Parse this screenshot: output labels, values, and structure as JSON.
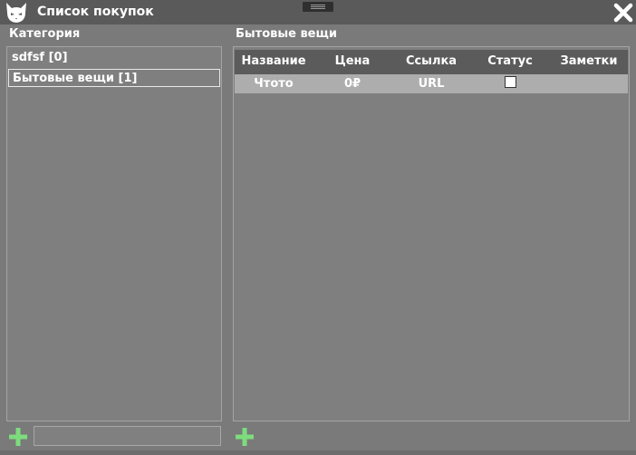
{
  "window": {
    "title": "Список покупок",
    "app_icon": "cat-head-icon",
    "close_icon": "close-icon"
  },
  "categories": {
    "header": "Категория",
    "items": [
      {
        "label": "sdfsf [0]",
        "selected": false
      },
      {
        "label": "Бытовые вещи [1]",
        "selected": true
      }
    ],
    "new_category_value": "",
    "add_icon": "plus-icon"
  },
  "items_panel": {
    "header": "Бытовые вещи",
    "columns": [
      "Название",
      "Цена",
      "Ссылка",
      "Статус",
      "Заметки"
    ],
    "rows": [
      {
        "name": "Чтото",
        "price": "0₽",
        "link": "URL",
        "status": false,
        "notes": ""
      }
    ],
    "add_icon": "plus-icon"
  },
  "colors": {
    "background": "#7a7a7a",
    "titlebar": "#5a5a5a",
    "table_header": "#5b5b5b",
    "row_highlight": "#adadad",
    "add_icon": "#7ddc7d"
  }
}
